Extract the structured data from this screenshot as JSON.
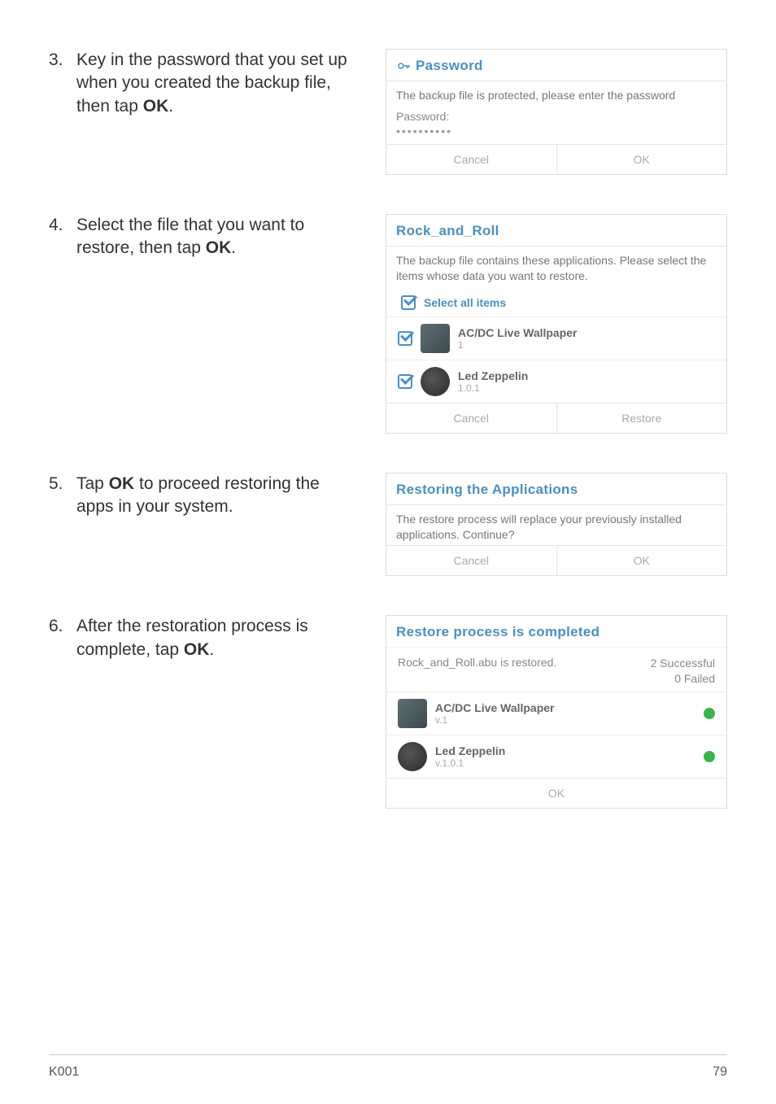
{
  "steps": {
    "s3": {
      "num": "3.",
      "text_a": "Key in the password that you set up when you created the backup file, then tap ",
      "strong": "OK",
      "text_b": "."
    },
    "s4": {
      "num": "4.",
      "text_a": "Select the file that you want to restore, then tap ",
      "strong": "OK",
      "text_b": "."
    },
    "s5": {
      "num": "5.",
      "text_a": "Tap ",
      "strong": "OK",
      "text_b": " to proceed restoring the apps in your system."
    },
    "s6": {
      "num": "6.",
      "text_a": "After the restoration process is complete, tap ",
      "strong": "OK",
      "text_b": "."
    }
  },
  "dialogs": {
    "password": {
      "title": "Password",
      "message": "The backup file is protected, please enter the password",
      "label": "Password:",
      "value": "••••••••••",
      "cancel": "Cancel",
      "ok": "OK"
    },
    "select_file": {
      "title": "Rock_and_Roll",
      "message": "The backup file contains these applications. Please select the items whose data you want to restore.",
      "select_all": "Select all items",
      "apps": [
        {
          "name": "AC/DC Live Wallpaper",
          "version": "1"
        },
        {
          "name": "Led Zeppelin",
          "version": "1.0.1"
        }
      ],
      "cancel": "Cancel",
      "restore": "Restore"
    },
    "restoring": {
      "title": "Restoring the Applications",
      "message": "The restore process will replace your previously installed applications. Continue?",
      "cancel": "Cancel",
      "ok": "OK"
    },
    "completed": {
      "title": "Restore process is completed",
      "status_text": "Rock_and_Roll.abu is restored.",
      "success": "2 Successful",
      "failed": "0 Failed",
      "apps": [
        {
          "name": "AC/DC Live Wallpaper",
          "version": "v.1"
        },
        {
          "name": "Led Zeppelin",
          "version": "v.1.0.1"
        }
      ],
      "ok": "OK"
    }
  },
  "footer": {
    "left": "K001",
    "right": "79"
  }
}
